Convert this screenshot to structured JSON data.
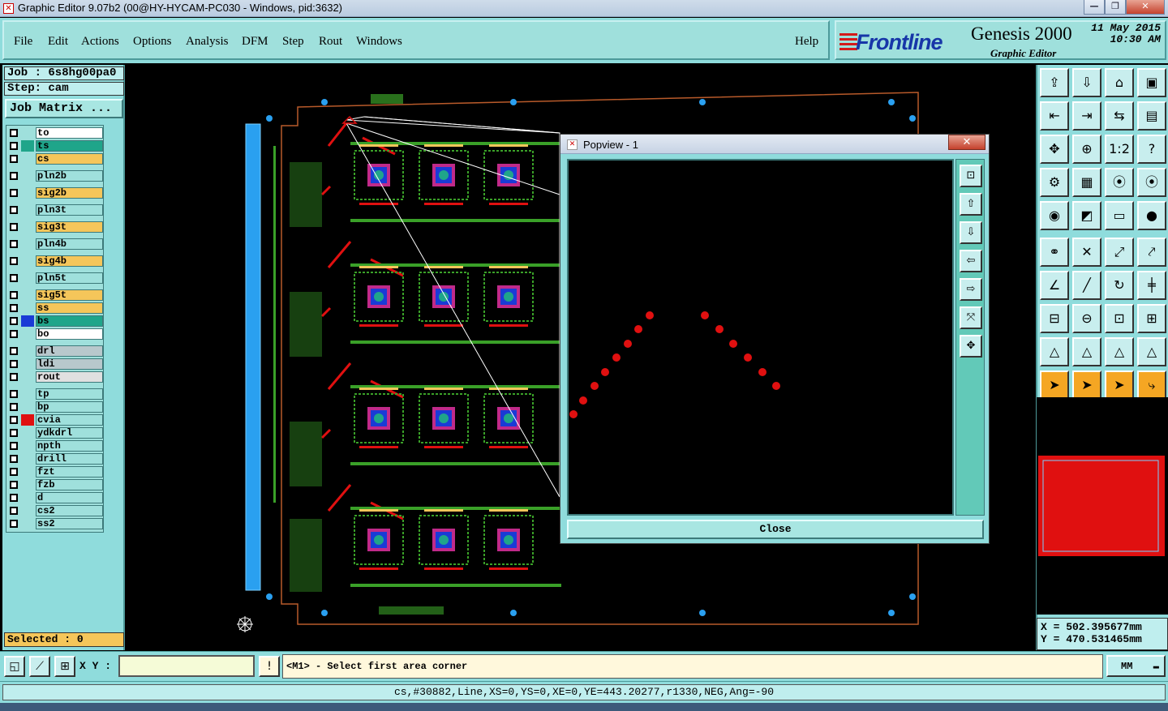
{
  "window": {
    "title": "Graphic Editor 9.07b2 (00@HY-HYCAM-PC030 - Windows, pid:3632)"
  },
  "menu": {
    "items": [
      "File",
      "Edit",
      "Actions",
      "Options",
      "Analysis",
      "DFM",
      "Step",
      "Rout",
      "Windows"
    ],
    "help": "Help"
  },
  "brand": {
    "name": "Frontline",
    "product": "Genesis 2000",
    "subtitle": "Graphic Editor",
    "date": "11 May 2015",
    "time": "10:30 AM"
  },
  "job": {
    "job": "Job : 6s8hg00pa0",
    "step": "Step: cam",
    "matrix_button": "Job Matrix ..."
  },
  "layers": [
    {
      "name": "to",
      "color": "#ffffff",
      "swatch": "",
      "icon": "✎"
    },
    {
      "name": "ts",
      "color": "#1fa58a",
      "swatch": "#1fa58a",
      "icon": ""
    },
    {
      "name": "cs",
      "color": "#f5c65a",
      "swatch": "",
      "icon": ""
    },
    {
      "name": "pln2b",
      "color": "#9fe0dc",
      "swatch": "",
      "icon": ""
    },
    {
      "name": "sig2b",
      "color": "#f5c65a",
      "swatch": "",
      "icon": ""
    },
    {
      "name": "pln3t",
      "color": "#9fe0dc",
      "swatch": "",
      "icon": ""
    },
    {
      "name": "sig3t",
      "color": "#f5c65a",
      "swatch": "",
      "icon": ""
    },
    {
      "name": "pln4b",
      "color": "#9fe0dc",
      "swatch": "",
      "icon": ""
    },
    {
      "name": "sig4b",
      "color": "#f5c65a",
      "swatch": "",
      "icon": ""
    },
    {
      "name": "pln5t",
      "color": "#9fe0dc",
      "swatch": "",
      "icon": ""
    },
    {
      "name": "sig5t",
      "color": "#f5c65a",
      "swatch": "",
      "icon": ""
    },
    {
      "name": "ss",
      "color": "#f5c65a",
      "swatch": "",
      "icon": ""
    },
    {
      "name": "bs",
      "color": "#1fa58a",
      "swatch": "#1a3bd6",
      "icon": ""
    },
    {
      "name": "bo",
      "color": "#ffffff",
      "swatch": "",
      "icon": "✎"
    },
    {
      "name": "drl",
      "color": "#b8c8cc",
      "swatch": "",
      "icon": ""
    },
    {
      "name": "ldi",
      "color": "#b8c8cc",
      "swatch": "",
      "icon": ""
    },
    {
      "name": "rout",
      "color": "#e0e0e0",
      "swatch": "",
      "icon": ""
    },
    {
      "name": "tp",
      "color": "#9fe0dc",
      "swatch": "",
      "icon": ""
    },
    {
      "name": "bp",
      "color": "#9fe0dc",
      "swatch": "",
      "icon": ""
    },
    {
      "name": "cvia",
      "color": "#9fe0dc",
      "swatch": "#e01010",
      "icon": "⊞"
    },
    {
      "name": "ydkdrl",
      "color": "#9fe0dc",
      "swatch": "",
      "icon": ""
    },
    {
      "name": "npth",
      "color": "#9fe0dc",
      "swatch": "",
      "icon": ""
    },
    {
      "name": "drill",
      "color": "#9fe0dc",
      "swatch": "",
      "icon": ""
    },
    {
      "name": "fzt",
      "color": "#9fe0dc",
      "swatch": "",
      "icon": ""
    },
    {
      "name": "fzb",
      "color": "#9fe0dc",
      "swatch": "",
      "icon": ""
    },
    {
      "name": "d",
      "color": "#9fe0dc",
      "swatch": "",
      "icon": ""
    },
    {
      "name": "cs2",
      "color": "#9fe0dc",
      "swatch": "",
      "icon": ""
    },
    {
      "name": "ss2",
      "color": "#9fe0dc",
      "swatch": "",
      "icon": ""
    }
  ],
  "selected": "Selected : 0",
  "popview": {
    "title": "Popview - 1",
    "close": "Close"
  },
  "coords": {
    "x": "X = 502.395677mm",
    "y": "Y = 470.531465mm"
  },
  "bottom": {
    "xy_label": "X Y :",
    "prompt": "<M1> - Select first area corner",
    "units": "MM"
  },
  "status": "cs,#30882,Line,XS=0,YS=0,XE=0,YE=443.20277,r1330,NEG,Ang=-90",
  "colors": {
    "panel": "#8fdcdc",
    "pad_red": "#e01010",
    "trace_green": "#3aa028",
    "fiducial_blue": "#2aa0f0"
  }
}
